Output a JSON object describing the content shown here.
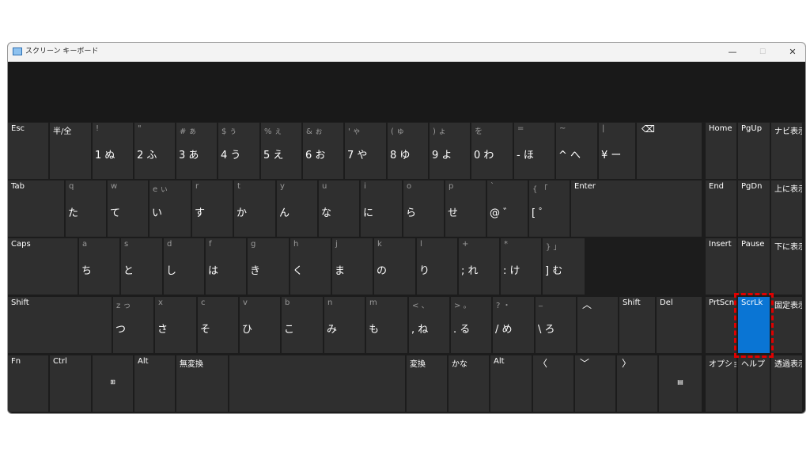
{
  "window": {
    "title": "スクリーン キーボード",
    "min_glyph": "—",
    "max_glyph": "☐",
    "close_glyph": "✕"
  },
  "accent_color": "#0a75d4",
  "highlight_border_color": "#e00000",
  "rows": [
    [
      {
        "name": "key-esc",
        "label": "Esc"
      },
      {
        "name": "key-hankaku-zenkaku",
        "label": "半/全"
      },
      {
        "name": "key-1",
        "sub": "!",
        "main": "1 ぬ"
      },
      {
        "name": "key-2",
        "sub": "\"",
        "main": "2 ふ"
      },
      {
        "name": "key-3",
        "sub": "# ぁ",
        "main": "3 あ"
      },
      {
        "name": "key-4",
        "sub": "$ ぅ",
        "main": "4 う"
      },
      {
        "name": "key-5",
        "sub": "% ぇ",
        "main": "5 え"
      },
      {
        "name": "key-6",
        "sub": "& ぉ",
        "main": "6 お"
      },
      {
        "name": "key-7",
        "sub": "' ゃ",
        "main": "7 や"
      },
      {
        "name": "key-8",
        "sub": "( ゅ",
        "main": "8 ゆ"
      },
      {
        "name": "key-9",
        "sub": ") ょ",
        "main": "9 よ"
      },
      {
        "name": "key-0",
        "sub": "を",
        "main": "0 わ"
      },
      {
        "name": "key-minus",
        "sub": "=",
        "main": "- ほ"
      },
      {
        "name": "key-caret",
        "sub": "~",
        "main": "^ へ"
      },
      {
        "name": "key-yen",
        "sub": "|",
        "main": "¥ ー"
      },
      {
        "name": "key-backspace",
        "icon": "⌫",
        "icon_name": "backspace-icon"
      },
      {
        "name": "key-home",
        "label": "Home"
      },
      {
        "name": "key-pgup",
        "label": "PgUp"
      },
      {
        "name": "key-navi-display",
        "label": "ナビ表示"
      }
    ],
    [
      {
        "name": "key-tab",
        "label": "Tab"
      },
      {
        "name": "key-q",
        "sub": "q",
        "main": "た"
      },
      {
        "name": "key-w",
        "sub": "w",
        "main": "て"
      },
      {
        "name": "key-e",
        "sub": "e ぃ",
        "main": "い"
      },
      {
        "name": "key-r",
        "sub": "r",
        "main": "す"
      },
      {
        "name": "key-t",
        "sub": "t",
        "main": "か"
      },
      {
        "name": "key-y",
        "sub": "y",
        "main": "ん"
      },
      {
        "name": "key-u",
        "sub": "u",
        "main": "な"
      },
      {
        "name": "key-i",
        "sub": "i",
        "main": "に"
      },
      {
        "name": "key-o",
        "sub": "o",
        "main": "ら"
      },
      {
        "name": "key-p",
        "sub": "p",
        "main": "せ"
      },
      {
        "name": "key-at",
        "sub": "`",
        "main": "@ ゛"
      },
      {
        "name": "key-open-bracket",
        "sub": "{ 「",
        "main": "[ ゜"
      },
      {
        "name": "key-enter",
        "label": "Enter"
      },
      {
        "name": "key-end",
        "label": "End"
      },
      {
        "name": "key-pgdn",
        "label": "PgDn"
      },
      {
        "name": "key-upper-display",
        "label": "上に表示"
      }
    ],
    [
      {
        "name": "key-caps",
        "label": "Caps"
      },
      {
        "name": "key-a",
        "sub": "a",
        "main": "ち"
      },
      {
        "name": "key-s",
        "sub": "s",
        "main": "と"
      },
      {
        "name": "key-d",
        "sub": "d",
        "main": "し"
      },
      {
        "name": "key-f",
        "sub": "f",
        "main": "は"
      },
      {
        "name": "key-g",
        "sub": "g",
        "main": "き"
      },
      {
        "name": "key-h",
        "sub": "h",
        "main": "く"
      },
      {
        "name": "key-j",
        "sub": "j",
        "main": "ま"
      },
      {
        "name": "key-k",
        "sub": "k",
        "main": "の"
      },
      {
        "name": "key-l",
        "sub": "l",
        "main": "り"
      },
      {
        "name": "key-semicolon",
        "sub": "+",
        "main": "; れ"
      },
      {
        "name": "key-colon",
        "sub": "*",
        "main": ": け"
      },
      {
        "name": "key-close-bracket",
        "sub": "} 」",
        "main": "] む"
      },
      {
        "name": "key-insert",
        "label": "Insert"
      },
      {
        "name": "key-pause",
        "label": "Pause"
      },
      {
        "name": "key-lower-display",
        "label": "下に表示"
      }
    ],
    [
      {
        "name": "key-shift-left",
        "label": "Shift"
      },
      {
        "name": "key-z",
        "sub": "z っ",
        "main": "つ"
      },
      {
        "name": "key-x",
        "sub": "x",
        "main": "さ"
      },
      {
        "name": "key-c",
        "sub": "c",
        "main": "そ"
      },
      {
        "name": "key-v",
        "sub": "v",
        "main": "ひ"
      },
      {
        "name": "key-b",
        "sub": "b",
        "main": "こ"
      },
      {
        "name": "key-n",
        "sub": "n",
        "main": "み"
      },
      {
        "name": "key-m",
        "sub": "m",
        "main": "も"
      },
      {
        "name": "key-comma",
        "sub": "< 、",
        "main": ", ね"
      },
      {
        "name": "key-period",
        "sub": "> 。",
        "main": ". る"
      },
      {
        "name": "key-slash",
        "sub": "? ・",
        "main": "/ め"
      },
      {
        "name": "key-backslash",
        "sub": "_",
        "main": "\\ ろ"
      },
      {
        "name": "key-arrow-up",
        "icon": "︿",
        "icon_name": "arrow-up-icon"
      },
      {
        "name": "key-shift-right",
        "label": "Shift"
      },
      {
        "name": "key-del",
        "label": "Del"
      },
      {
        "name": "key-prtscn",
        "label": "PrtScn"
      },
      {
        "name": "key-scrlk",
        "label": "ScrLk"
      },
      {
        "name": "key-fixed-display",
        "label": "固定表示"
      }
    ],
    [
      {
        "name": "key-fn",
        "label": "Fn"
      },
      {
        "name": "key-ctrl",
        "label": "Ctrl"
      },
      {
        "name": "key-windows",
        "glyph": "⊞",
        "glyph_name": "windows-icon"
      },
      {
        "name": "key-alt-left",
        "label": "Alt"
      },
      {
        "name": "key-muhenkan",
        "label": "無変換"
      },
      {
        "name": "key-space",
        "label": ""
      },
      {
        "name": "key-henkan",
        "label": "変換"
      },
      {
        "name": "key-kana",
        "label": "かな"
      },
      {
        "name": "key-alt-right",
        "label": "Alt"
      },
      {
        "name": "key-arrow-left",
        "icon": "〈",
        "icon_name": "arrow-left-icon"
      },
      {
        "name": "key-arrow-down",
        "icon": "﹀",
        "icon_name": "arrow-down-icon"
      },
      {
        "name": "key-arrow-right",
        "icon": "〉",
        "icon_name": "arrow-right-icon"
      },
      {
        "name": "key-menu",
        "glyph": "▤",
        "glyph_name": "menu-icon"
      },
      {
        "name": "key-options",
        "label": "オプション"
      },
      {
        "name": "key-help",
        "label": "ヘルプ"
      },
      {
        "name": "key-transparent-display",
        "label": "透過表示"
      }
    ]
  ]
}
